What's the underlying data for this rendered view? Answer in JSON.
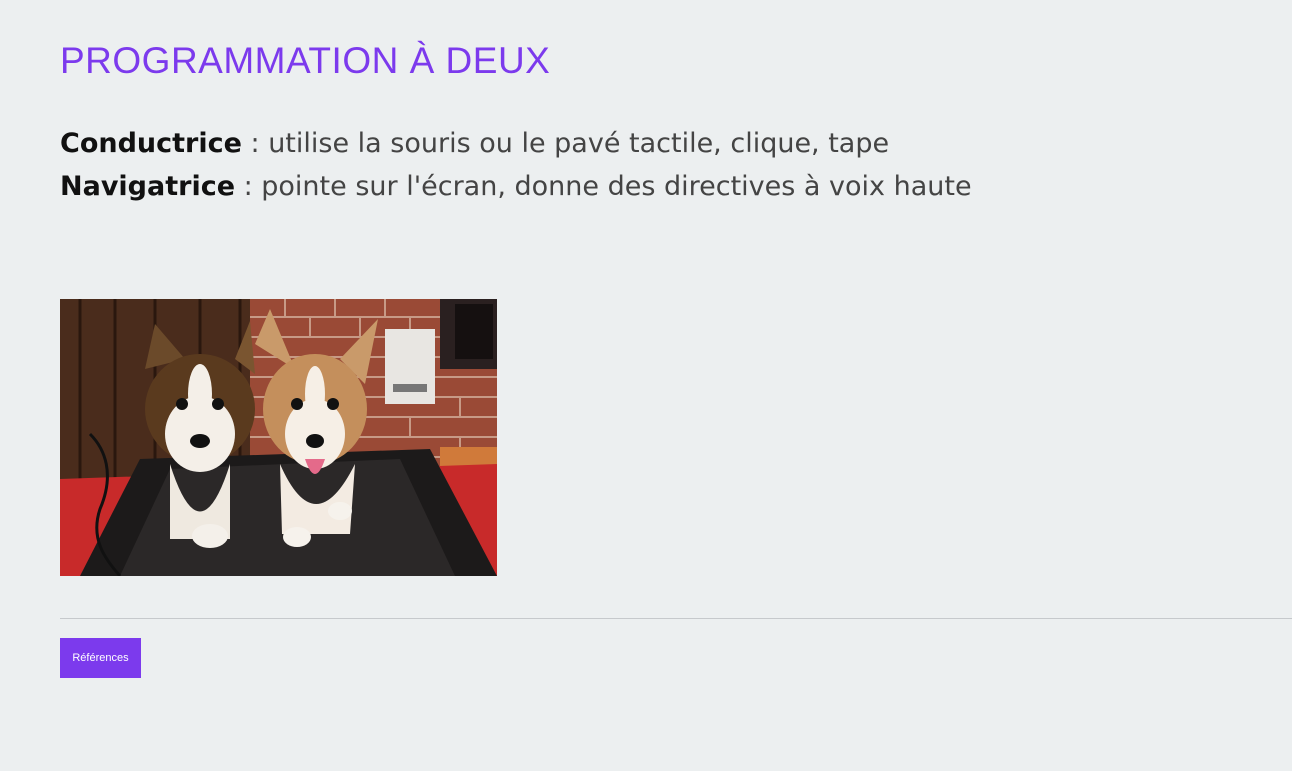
{
  "slide": {
    "title": "PROGRAMMATION À DEUX",
    "roles": [
      {
        "name": "Conductrice",
        "description": " : utilise la souris ou le pavé tactile, clique, tape"
      },
      {
        "name": "Navigatrice",
        "description": " : pointe sur l'écran, donne des directives à voix haute"
      }
    ]
  },
  "footer": {
    "references_label": "Références"
  },
  "colors": {
    "accent": "#7c3aed",
    "background": "#eceff0"
  }
}
